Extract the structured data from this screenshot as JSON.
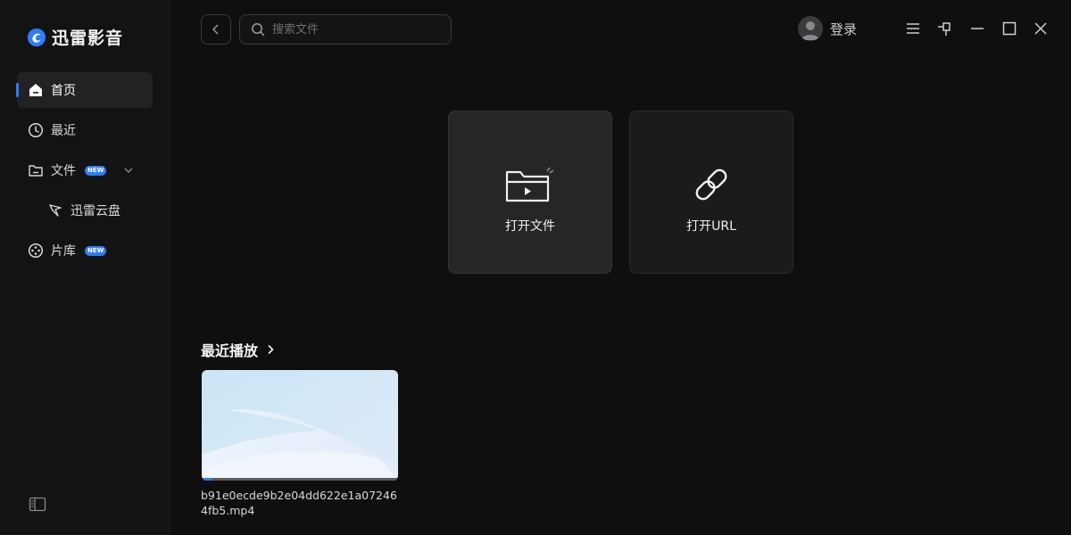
{
  "app": {
    "name": "迅雷影音"
  },
  "sidebar": {
    "items": [
      {
        "label": "首页",
        "icon": "home-icon",
        "active": true
      },
      {
        "label": "最近",
        "icon": "clock-icon"
      },
      {
        "label": "文件",
        "icon": "folder-icon",
        "badge": "NEW"
      },
      {
        "label": "迅雷云盘",
        "icon": "cloud-drive-icon"
      },
      {
        "label": "片库",
        "icon": "film-reel-icon",
        "badge": "NEW"
      }
    ]
  },
  "toolbar": {
    "search_placeholder": "搜索文件",
    "login_label": "登录"
  },
  "actions": {
    "open_file_label": "打开文件",
    "open_url_label": "打开URL"
  },
  "recent": {
    "title": "最近播放",
    "items": [
      {
        "filename": "b91e0ecde9b2e04dd622e1a072464fb5.mp4",
        "progress": 0.05
      }
    ]
  },
  "colors": {
    "accent": "#2f7cf6",
    "background": "#0f0f10",
    "sidebar": "#131314"
  }
}
